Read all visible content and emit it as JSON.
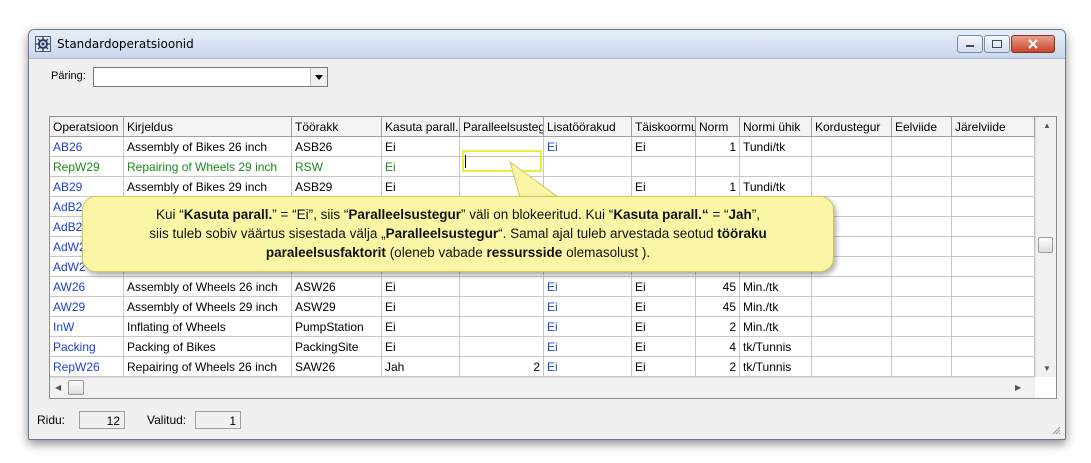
{
  "window": {
    "title": "Standardoperatsioonid"
  },
  "query": {
    "label": "Päring:",
    "value": ""
  },
  "grid": {
    "columns": [
      "Operatsioon",
      "Kirjeldus",
      "Töörakk",
      "Kasuta parall.",
      "Paralleelsusteg",
      "Lisatöörakud",
      "Täiskoormu",
      "Norm",
      "Normi ühik",
      "Kordustegur",
      "Eelviide",
      "Järelviide"
    ],
    "rows": [
      {
        "op": "AB26",
        "desc": "Assembly of Bikes 26 inch",
        "cell": "ASB26",
        "par": "Ei",
        "pf": "",
        "extra": "Ei",
        "full": "Ei",
        "norm": "1",
        "unit": "Tundi/tk"
      },
      {
        "op": "RepW29",
        "desc": "Repairing of Wheels 29 inch",
        "cell": "RSW",
        "par": "Ei",
        "pf": "",
        "extra": "",
        "full": "",
        "norm": "",
        "unit": ""
      },
      {
        "op": "AB29",
        "desc": "Assembly of Bikes 29 inch",
        "cell": "ASB29",
        "par": "Ei",
        "pf": "",
        "extra": "",
        "full": "Ei",
        "norm": "1",
        "unit": "Tundi/tk"
      },
      {
        "op": "AdB2",
        "desc": "",
        "cell": "",
        "par": "",
        "pf": "",
        "extra": "",
        "full": "",
        "norm": "",
        "unit": ""
      },
      {
        "op": "AdB2",
        "desc": "",
        "cell": "",
        "par": "",
        "pf": "",
        "extra": "",
        "full": "",
        "norm": "",
        "unit": ""
      },
      {
        "op": "AdW2",
        "desc": "",
        "cell": "",
        "par": "",
        "pf": "",
        "extra": "",
        "full": "",
        "norm": "",
        "unit": ""
      },
      {
        "op": "AdW2",
        "desc": "",
        "cell": "",
        "par": "",
        "pf": "",
        "extra": "",
        "full": "",
        "norm": "",
        "unit": ""
      },
      {
        "op": "AW26",
        "desc": "Assembly of Wheels 26 inch",
        "cell": "ASW26",
        "par": "Ei",
        "pf": "",
        "extra": "Ei",
        "full": "Ei",
        "norm": "45",
        "unit": "Min./tk"
      },
      {
        "op": "AW29",
        "desc": "Assembly of Wheels 29 inch",
        "cell": "ASW29",
        "par": "Ei",
        "pf": "",
        "extra": "Ei",
        "full": "Ei",
        "norm": "45",
        "unit": "Min./tk"
      },
      {
        "op": "InW",
        "desc": "Inflating of Wheels",
        "cell": "PumpStation",
        "par": "Ei",
        "pf": "",
        "extra": "Ei",
        "full": "Ei",
        "norm": "2",
        "unit": "Min./tk"
      },
      {
        "op": "Packing",
        "desc": "Packing of Bikes",
        "cell": "PackingSite",
        "par": "Ei",
        "pf": "",
        "extra": "Ei",
        "full": "Ei",
        "norm": "4",
        "unit": "tk/Tunnis"
      },
      {
        "op": "RepW26",
        "desc": "Repairing of Wheels 26 inch",
        "cell": "SAW26",
        "par": "Jah",
        "pf": "2",
        "extra": "Ei",
        "full": "Ei",
        "norm": "2",
        "unit": "tk/Tunnis"
      }
    ]
  },
  "status": {
    "rows_label": "Ridu:",
    "rows_value": "12",
    "selected_label": "Valitud:",
    "selected_value": "1"
  },
  "callout": {
    "line1_a": "Kui “",
    "line1_b": "Kasuta parall.",
    "line1_c": "” = “Ei”, siis “",
    "line1_d": "Paralleelsustegur",
    "line1_e": "” väli on blokeeritud.  Kui “",
    "line1_f": "Kasuta parall.“",
    "line1_g": "  = “",
    "line1_h": "Jah",
    "line1_i": "”,",
    "line2_a": "siis tuleb sobiv väärtus sisestada välja „",
    "line2_b": "Paralleelsustegur",
    "line2_c": "“. Samal ajal tuleb arvestada seotud ",
    "line2_d": "tööraku",
    "line3_a": "paraleelsusfaktorit",
    "line3_b": " (oleneb vabade ",
    "line3_c": "ressursside",
    "line3_d": " olemasolust )."
  },
  "colors": {
    "link_blue": "#1d3fd4",
    "edit_green": "#1b8a1b",
    "callout_fill": "#fbf6a6",
    "highlight": "#eaf03a"
  }
}
